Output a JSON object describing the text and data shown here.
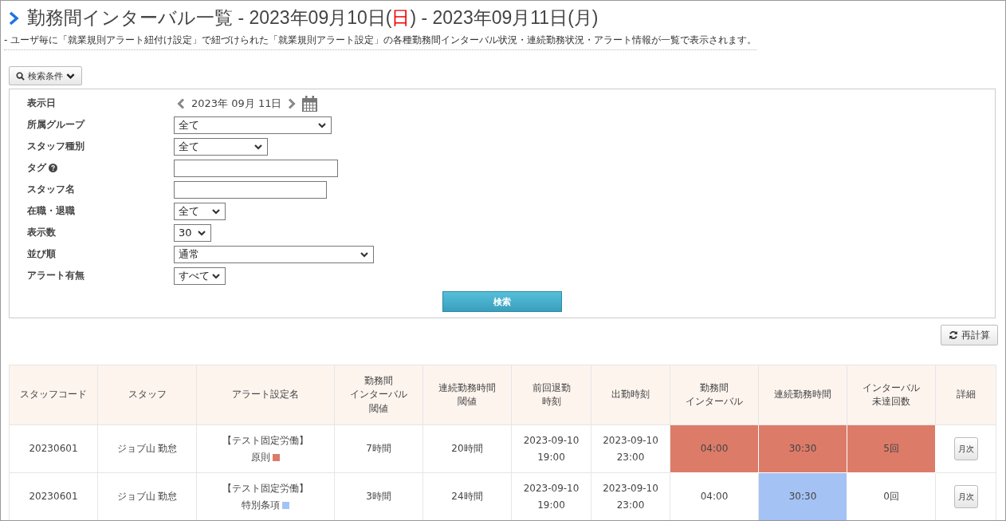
{
  "title": [
    {
      "text": "勤務間インターバル一覧 - 2023年09月10日(",
      "sunday": false
    },
    {
      "text": "日",
      "sunday": true
    },
    {
      "text": ") - 2023年09月11日(月)",
      "sunday": false
    }
  ],
  "description": "- ユーザ毎に「就業規則アラート紐付け設定」で紐づけられた「就業規則アラート設定」の各種勤務間インターバル状況・連続勤務状況・アラート情報が一覧で表示されます。",
  "search_toggle": "検索条件",
  "form": [
    {
      "kind": "date",
      "label": "表示日",
      "value": "2023年 09月 11日"
    },
    {
      "kind": "select",
      "label": "所属グループ",
      "value": "全て"
    },
    {
      "kind": "select",
      "label": "スタッフ種別",
      "value": "全て"
    },
    {
      "kind": "input",
      "label": "タグ",
      "help": true
    },
    {
      "kind": "input",
      "label": "スタッフ名",
      "help": false
    },
    {
      "kind": "select",
      "label": "在職・退職",
      "value": "全て"
    },
    {
      "kind": "select",
      "label": "表示数",
      "value": "30"
    },
    {
      "kind": "select",
      "label": "並び順",
      "value": "通常"
    },
    {
      "kind": "select",
      "label": "アラート有無",
      "value": "すべて"
    }
  ],
  "search_button": "検索",
  "recalc_button": "再計算",
  "table": {
    "columns": [
      [
        "スタッフコード"
      ],
      [
        "スタッフ"
      ],
      [
        "アラート設定名"
      ],
      [
        "勤務間",
        "インターバル",
        "閾値"
      ],
      [
        "連続勤務時間",
        "閾値"
      ],
      [
        "前回退勤",
        "時刻"
      ],
      [
        "出勤時刻"
      ],
      [
        "勤務間",
        "インターバル"
      ],
      [
        "連続勤務時間"
      ],
      [
        "インターバル",
        "未達回数"
      ],
      [
        "詳細"
      ]
    ],
    "rows": [
      {
        "code": "20230601",
        "staff": "ジョブ山 勤怠",
        "alert": {
          "group": "【テスト固定労働】",
          "name": "原則",
          "color": "#dd7b69"
        },
        "interval_threshold": "7時間",
        "continuous_threshold": "20時間",
        "last_leave": "2023-09-10\n19:00",
        "clock_in": "2023-09-10\n23:00",
        "interval": {
          "text": "04:00",
          "color": "#dd7b69"
        },
        "continuous": {
          "text": "30:30",
          "color": "#dd7b69"
        },
        "shortfall": {
          "text": "5回",
          "color": "#dd7b69"
        },
        "detail": "月次"
      },
      {
        "code": "20230601",
        "staff": "ジョブ山 勤怠",
        "alert": {
          "group": "【テスト固定労働】",
          "name": "特別条項",
          "color": "#a4c2f4"
        },
        "interval_threshold": "3時間",
        "continuous_threshold": "24時間",
        "last_leave": "2023-09-10\n19:00",
        "clock_in": "2023-09-10\n23:00",
        "interval": {
          "text": "04:00"
        },
        "continuous": {
          "text": "30:30",
          "color": "#a4c2f4"
        },
        "shortfall": {
          "text": "0回"
        },
        "detail": "月次"
      }
    ]
  }
}
